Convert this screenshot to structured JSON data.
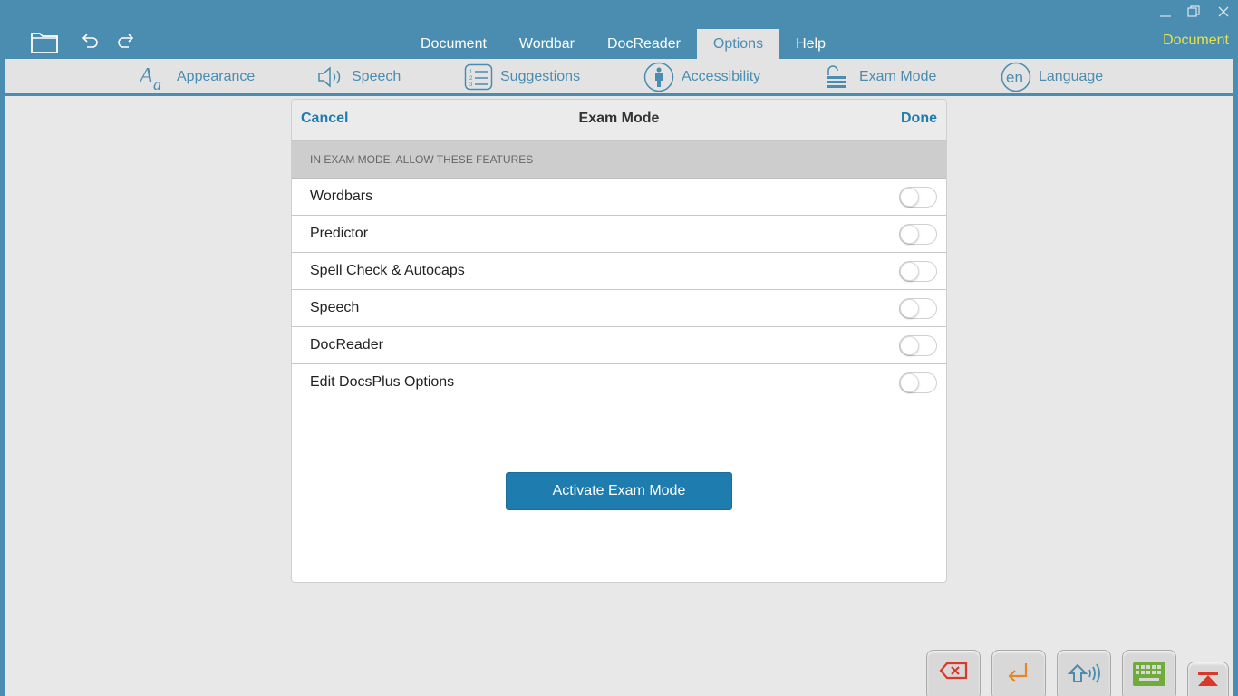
{
  "window": {
    "document_label": "Document",
    "minimize_icon": "minimize-icon",
    "restore_icon": "restore-icon",
    "close_icon": "close-icon"
  },
  "menu": {
    "items": [
      {
        "label": "Document",
        "active": false
      },
      {
        "label": "Wordbar",
        "active": false
      },
      {
        "label": "DocReader",
        "active": false
      },
      {
        "label": "Options",
        "active": true
      },
      {
        "label": "Help",
        "active": false
      }
    ]
  },
  "toolbar": {
    "items": [
      {
        "label": "Appearance",
        "icon": "font-appearance-icon"
      },
      {
        "label": "Speech",
        "icon": "speaker-icon"
      },
      {
        "label": "Suggestions",
        "icon": "numbered-list-icon"
      },
      {
        "label": "Accessibility",
        "icon": "person-icon"
      },
      {
        "label": "Exam Mode",
        "icon": "unlock-icon"
      },
      {
        "label": "Language",
        "icon": "language-en-icon"
      }
    ]
  },
  "dialog": {
    "cancel_label": "Cancel",
    "title": "Exam Mode",
    "done_label": "Done",
    "section_header": "IN EXAM MODE, ALLOW THESE FEATURES",
    "options": [
      {
        "label": "Wordbars",
        "enabled": false
      },
      {
        "label": "Predictor",
        "enabled": false
      },
      {
        "label": "Spell Check & Autocaps",
        "enabled": false
      },
      {
        "label": "Speech",
        "enabled": false
      },
      {
        "label": "DocReader",
        "enabled": false
      },
      {
        "label": "Edit DocsPlus Options",
        "enabled": false
      }
    ],
    "activate_label": "Activate Exam Mode"
  },
  "keys": [
    "backspace-icon",
    "enter-icon",
    "speak-icon",
    "keyboard-icon",
    "collapse-icon"
  ],
  "colors": {
    "brand": "#4a8db0",
    "accent_button": "#1f7cae",
    "doc_label": "#e8e24a",
    "key_orange": "#e8852a",
    "key_green": "#6fac3a",
    "key_red": "#d9392b"
  }
}
